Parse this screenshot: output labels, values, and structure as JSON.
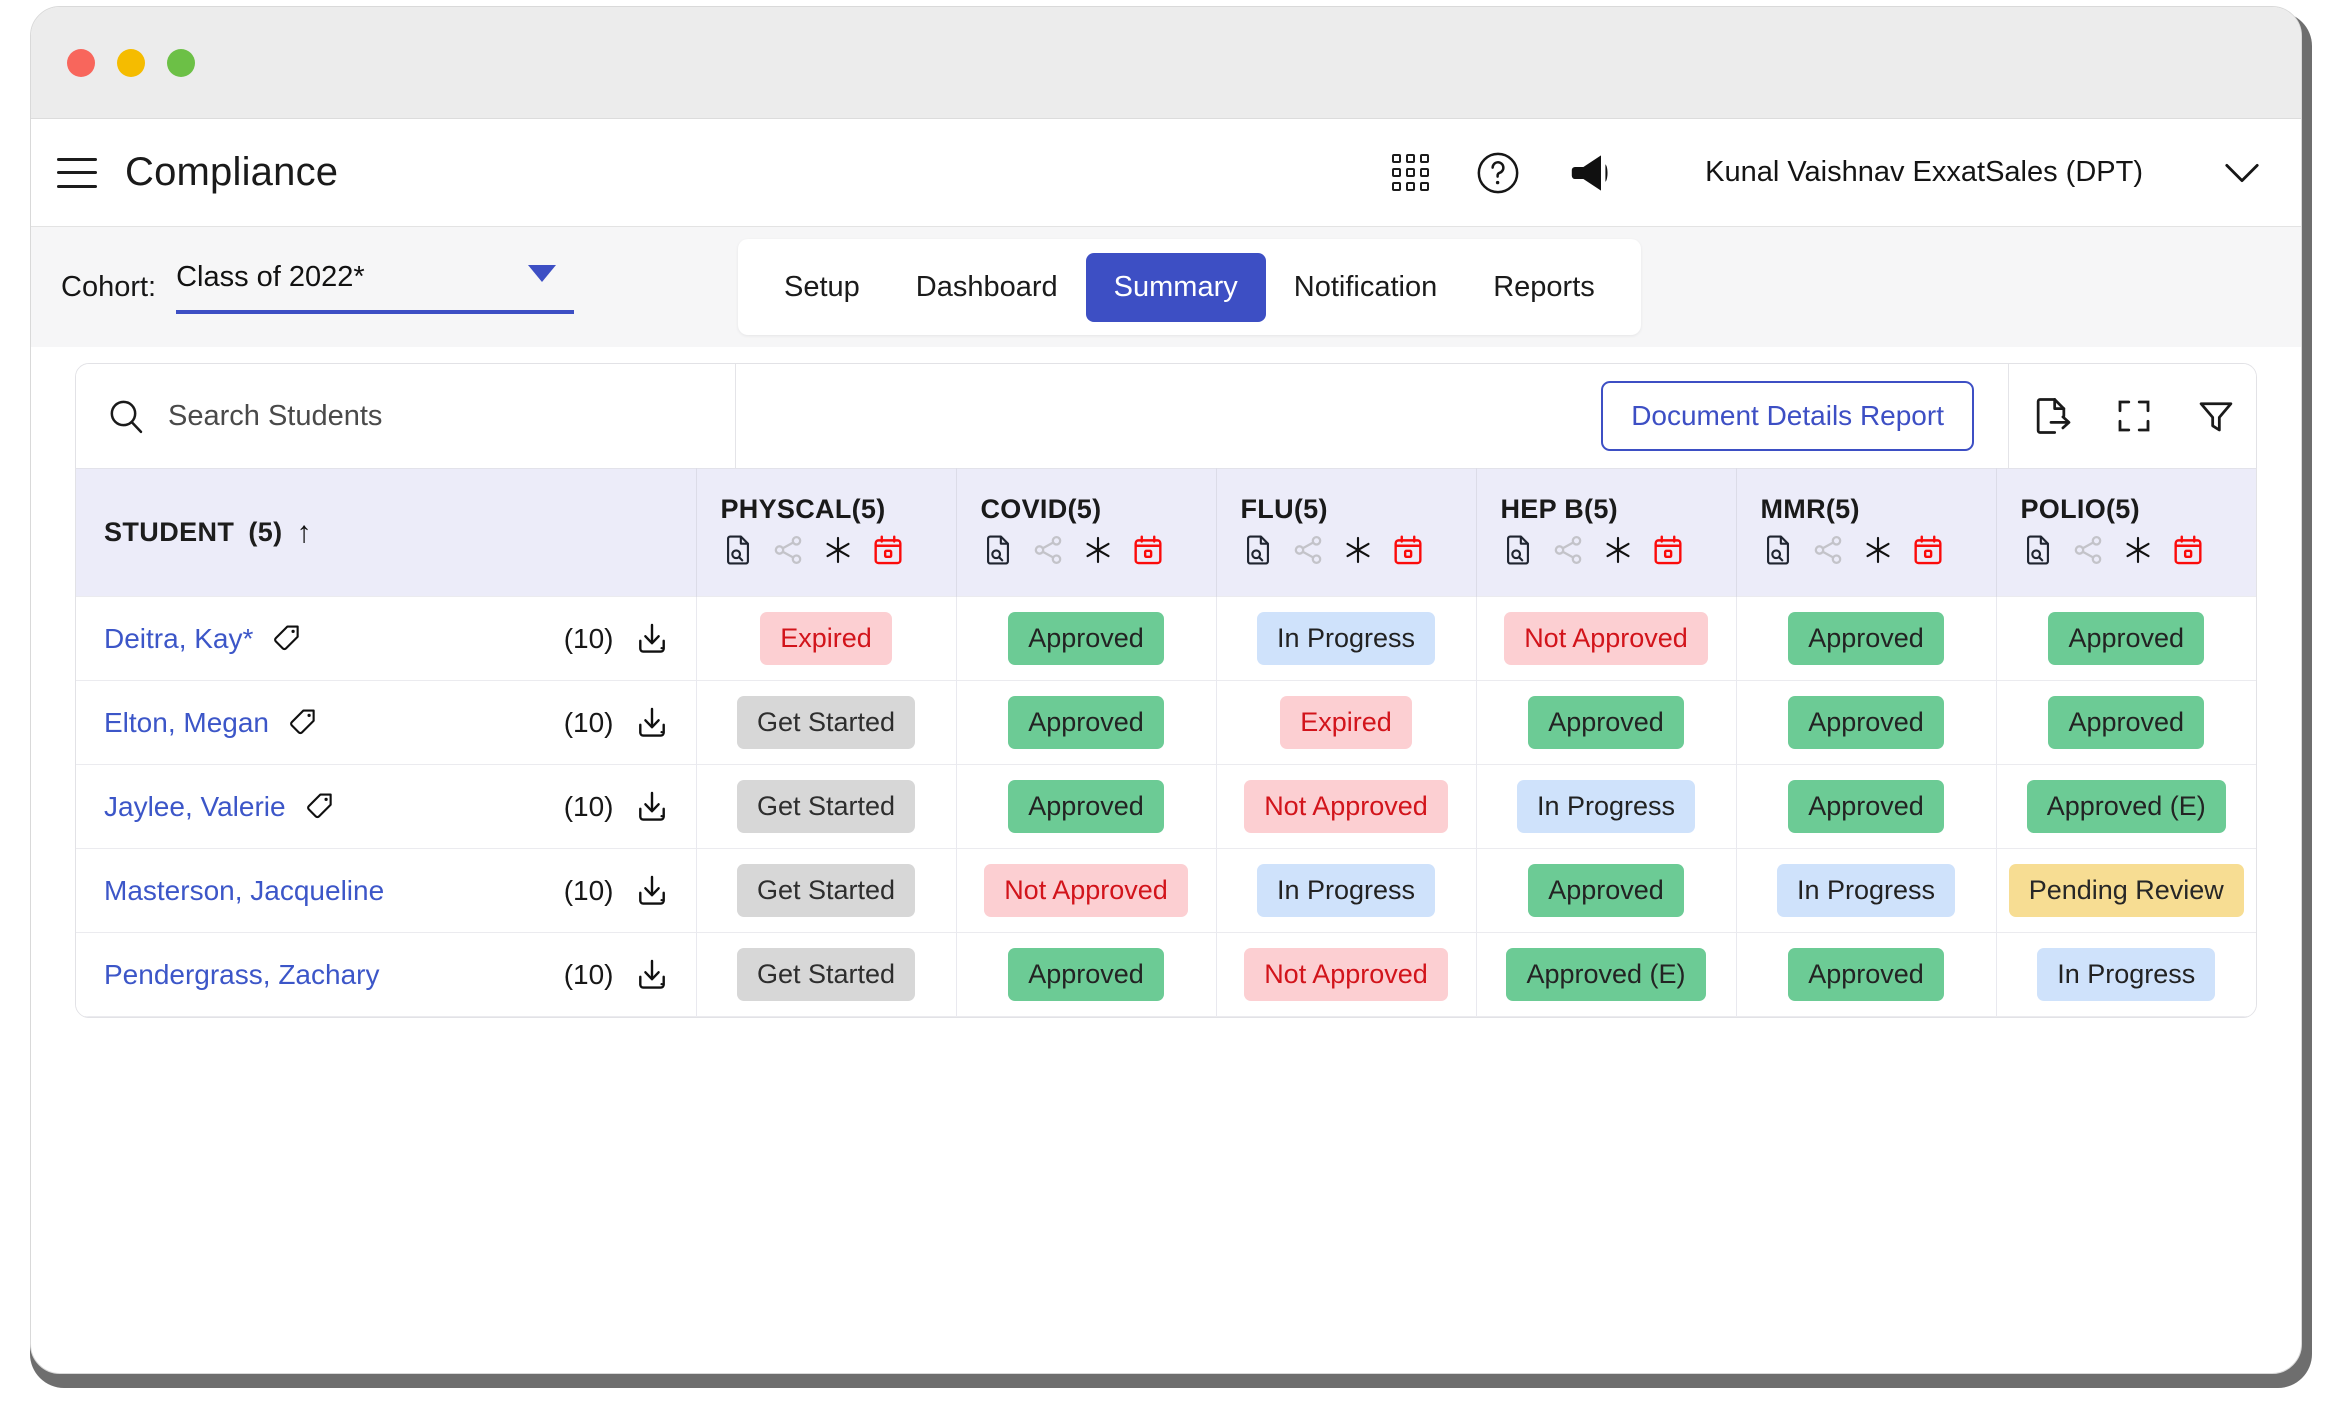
{
  "window": {
    "traffic_lights": [
      "close",
      "minimize",
      "maximize"
    ]
  },
  "header": {
    "title": "Compliance",
    "menu_icon": "hamburger-icon",
    "apps_icon": "apps-grid-icon",
    "help_icon": "help-circle-icon",
    "announcement_icon": "megaphone-icon",
    "user_name": "Kunal Vaishnav  ExxatSales (DPT)",
    "chevron_icon": "chevron-down-icon"
  },
  "subheader": {
    "cohort_label": "Cohort:",
    "cohort_value": "Class of 2022*",
    "tabs": [
      {
        "label": "Setup",
        "active": false
      },
      {
        "label": "Dashboard",
        "active": false
      },
      {
        "label": "Summary",
        "active": true
      },
      {
        "label": "Notification",
        "active": false
      },
      {
        "label": "Reports",
        "active": false
      }
    ]
  },
  "toolbar": {
    "search_placeholder": "Search Students",
    "search_value": "",
    "document_details_report": "Document Details Report",
    "icons": [
      "export-icon",
      "fullscreen-icon",
      "filter-icon"
    ]
  },
  "table": {
    "student_column": {
      "label": "STUDENT",
      "count": "(5)",
      "sort": "ascending"
    },
    "columns": [
      {
        "label": "PHYSCAL(5)",
        "icons": [
          "document-search-icon",
          "share-icon",
          "asterisk-icon",
          "calendar-icon"
        ]
      },
      {
        "label": "COVID(5)",
        "icons": [
          "document-search-icon",
          "share-icon",
          "asterisk-icon",
          "calendar-icon"
        ]
      },
      {
        "label": "FLU(5)",
        "icons": [
          "document-search-icon",
          "share-icon",
          "asterisk-icon",
          "calendar-icon"
        ]
      },
      {
        "label": "HEP B(5)",
        "icons": [
          "document-search-icon",
          "share-icon",
          "asterisk-icon",
          "calendar-icon"
        ]
      },
      {
        "label": "MMR(5)",
        "icons": [
          "document-search-icon",
          "share-icon",
          "asterisk-icon",
          "calendar-icon"
        ]
      },
      {
        "label": "POLIO(5)",
        "icons": [
          "document-search-icon",
          "share-icon",
          "asterisk-icon",
          "calendar-icon"
        ]
      }
    ],
    "rows": [
      {
        "name": "Deitra, Kay*",
        "has_tag": true,
        "doc_count": "(10)",
        "statuses": [
          {
            "label": "Expired",
            "kind": "expired"
          },
          {
            "label": "Approved",
            "kind": "approved"
          },
          {
            "label": "In Progress",
            "kind": "in-progress"
          },
          {
            "label": "Not Approved",
            "kind": "not-approved"
          },
          {
            "label": "Approved",
            "kind": "approved"
          },
          {
            "label": "Approved",
            "kind": "approved"
          }
        ]
      },
      {
        "name": "Elton, Megan",
        "has_tag": true,
        "doc_count": "(10)",
        "statuses": [
          {
            "label": "Get Started",
            "kind": "get-started"
          },
          {
            "label": "Approved",
            "kind": "approved"
          },
          {
            "label": "Expired",
            "kind": "expired"
          },
          {
            "label": "Approved",
            "kind": "approved"
          },
          {
            "label": "Approved",
            "kind": "approved"
          },
          {
            "label": "Approved",
            "kind": "approved"
          }
        ]
      },
      {
        "name": "Jaylee, Valerie",
        "has_tag": true,
        "doc_count": "(10)",
        "statuses": [
          {
            "label": "Get Started",
            "kind": "get-started"
          },
          {
            "label": "Approved",
            "kind": "approved"
          },
          {
            "label": "Not Approved",
            "kind": "not-approved"
          },
          {
            "label": "In Progress",
            "kind": "in-progress"
          },
          {
            "label": "Approved",
            "kind": "approved"
          },
          {
            "label": "Approved (E)",
            "kind": "approved"
          }
        ]
      },
      {
        "name": "Masterson, Jacqueline",
        "has_tag": false,
        "doc_count": "(10)",
        "statuses": [
          {
            "label": "Get Started",
            "kind": "get-started"
          },
          {
            "label": "Not Approved",
            "kind": "not-approved"
          },
          {
            "label": "In Progress",
            "kind": "in-progress"
          },
          {
            "label": "Approved",
            "kind": "approved"
          },
          {
            "label": "In Progress",
            "kind": "in-progress"
          },
          {
            "label": "Pending Review",
            "kind": "pending"
          }
        ]
      },
      {
        "name": "Pendergrass, Zachary",
        "has_tag": false,
        "doc_count": "(10)",
        "statuses": [
          {
            "label": "Get Started",
            "kind": "get-started"
          },
          {
            "label": "Approved",
            "kind": "approved"
          },
          {
            "label": "Not Approved",
            "kind": "not-approved"
          },
          {
            "label": "Approved (E)",
            "kind": "approved"
          },
          {
            "label": "Approved",
            "kind": "approved"
          },
          {
            "label": "In Progress",
            "kind": "in-progress"
          }
        ]
      }
    ]
  },
  "colors": {
    "accent": "#3d4fc4",
    "approved": "#6ccb95",
    "expired_bg": "#fccfd2",
    "expired_text": "#d2141b",
    "in_progress": "#cfe2fb",
    "pending": "#f7dd93",
    "get_started": "#d7d7d7",
    "header_bg": "#ececf9",
    "link": "#3c56c8"
  }
}
